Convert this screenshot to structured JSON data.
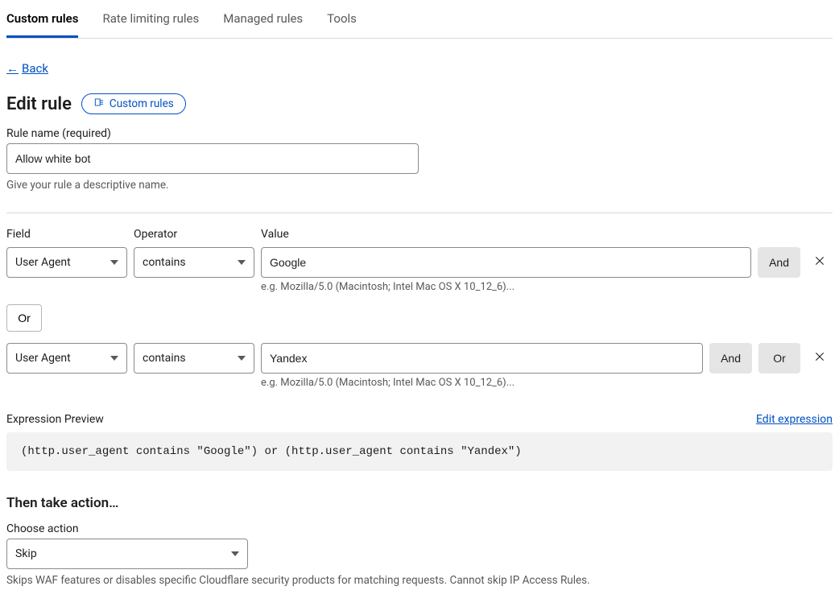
{
  "tabs": {
    "items": [
      {
        "label": "Custom rules",
        "active": true
      },
      {
        "label": "Rate limiting rules",
        "active": false
      },
      {
        "label": "Managed rules",
        "active": false
      },
      {
        "label": "Tools",
        "active": false
      }
    ]
  },
  "back_label": "Back",
  "page_title": "Edit rule",
  "badge_label": "Custom rules",
  "rule_name": {
    "label": "Rule name (required)",
    "value": "Allow white bot",
    "hint": "Give your rule a descriptive name."
  },
  "columns": {
    "field": "Field",
    "operator": "Operator",
    "value": "Value"
  },
  "rows": [
    {
      "field": "User Agent",
      "operator": "contains",
      "value": "Google",
      "value_hint": "e.g. Mozilla/5.0 (Macintosh; Intel Mac OS X 10_12_6)...",
      "buttons": [
        "And"
      ]
    },
    {
      "field": "User Agent",
      "operator": "contains",
      "value": "Yandex",
      "value_hint": "e.g. Mozilla/5.0 (Macintosh; Intel Mac OS X 10_12_6)...",
      "buttons": [
        "And",
        "Or"
      ]
    }
  ],
  "connector_or": "Or",
  "expression_preview": {
    "label": "Expression Preview",
    "edit_link": "Edit expression",
    "code": "(http.user_agent contains \"Google\") or (http.user_agent contains \"Yandex\")"
  },
  "action": {
    "heading": "Then take action…",
    "label": "Choose action",
    "value": "Skip",
    "hint": "Skips WAF features or disables specific Cloudflare security products for matching requests. Cannot skip IP Access Rules."
  }
}
